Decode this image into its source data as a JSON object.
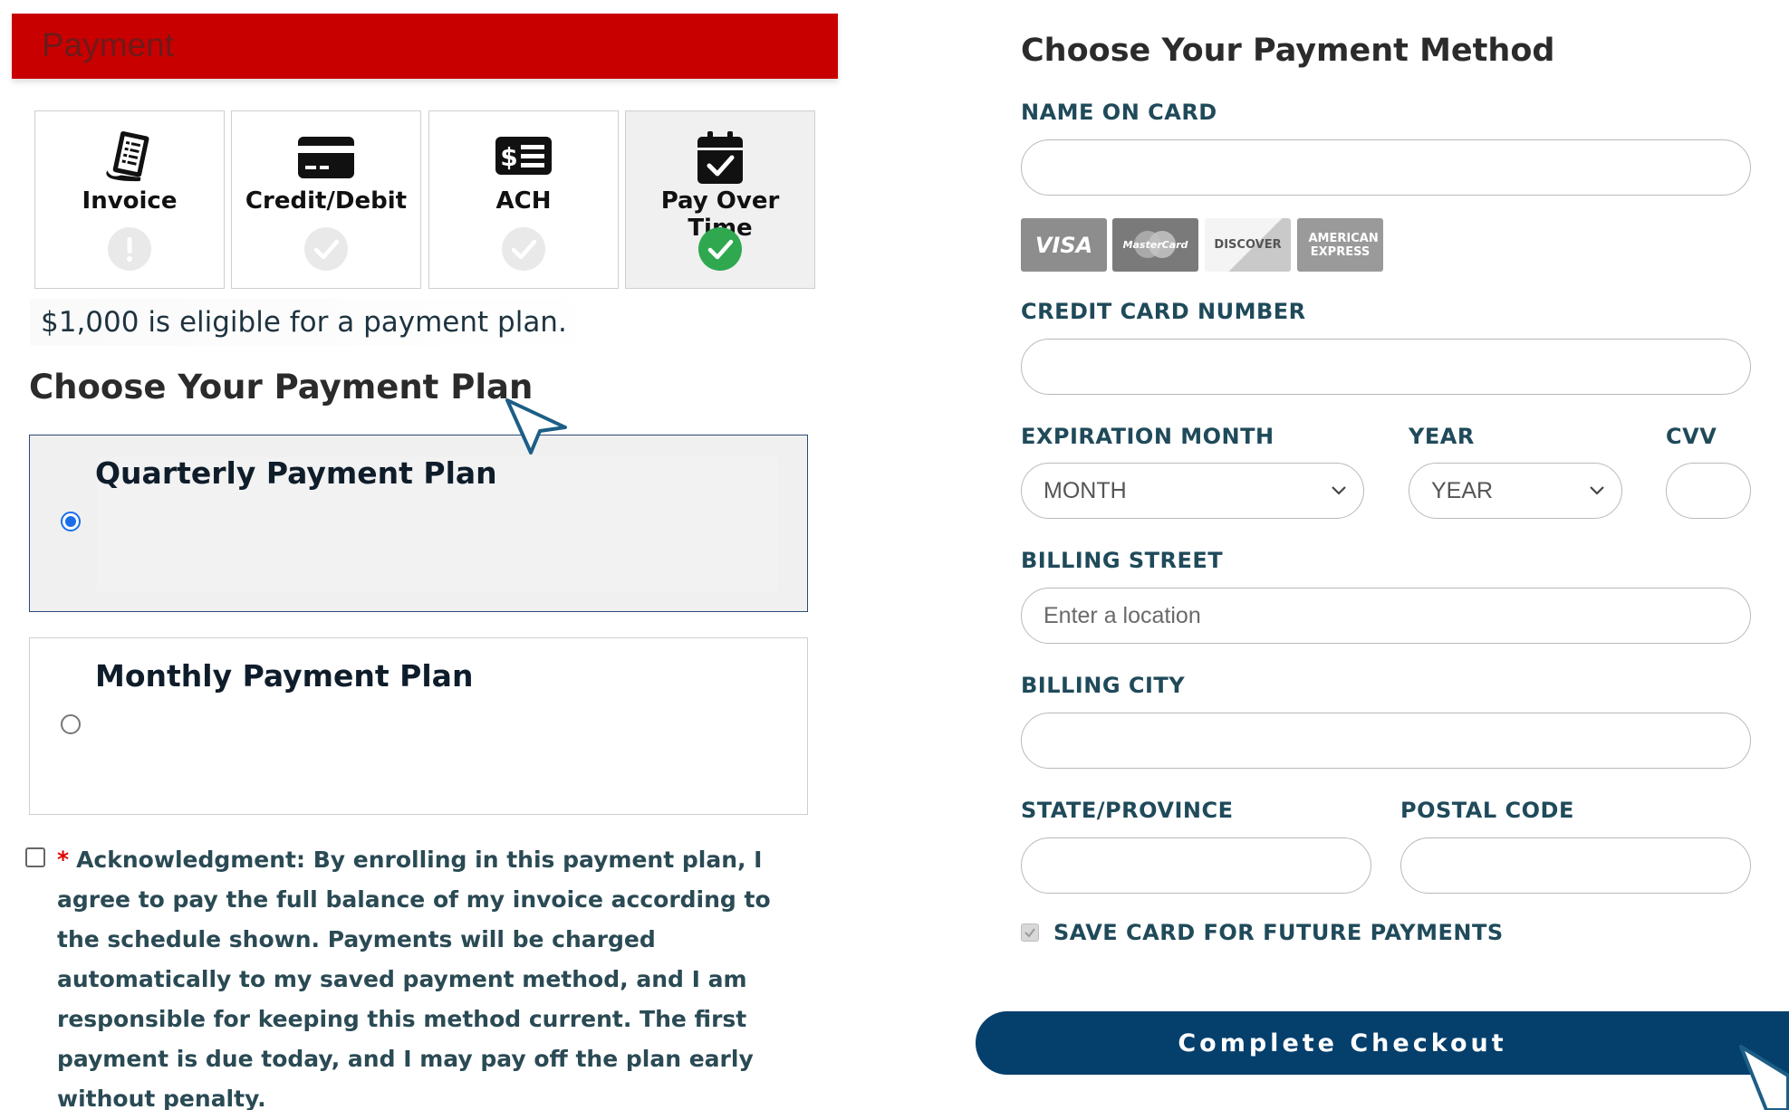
{
  "header": {
    "title": "Payment"
  },
  "tabs": [
    {
      "label": "Invoice",
      "icon": "invoice-icon",
      "status": "warning"
    },
    {
      "label": "Credit/Debit",
      "icon": "credit-card-icon",
      "status": "check"
    },
    {
      "label": "ACH",
      "icon": "ach-icon",
      "status": "check"
    },
    {
      "label": "Pay Over Time",
      "icon": "calendar-check-icon",
      "status": "selected"
    }
  ],
  "eligibility_text": "$1,000 is eligible for a payment plan.",
  "plan_section": {
    "heading": "Choose Your Payment Plan",
    "plans": [
      {
        "title": "Quarterly Payment Plan",
        "selected": true
      },
      {
        "title": "Monthly Payment Plan",
        "selected": false
      }
    ]
  },
  "acknowledgment": {
    "required_mark": "*",
    "text": "Acknowledgment: By enrolling in this payment plan, I agree to pay the full balance of my invoice according to the schedule shown. Payments will be charged automatically to my saved payment method, and I am responsible for keeping this method current. The first payment is due today, and I may pay off the plan early without penalty."
  },
  "payment_method": {
    "heading": "Choose Your Payment Method",
    "name_on_card_label": "NAME ON CARD",
    "card_brands": [
      "VISA",
      "MasterCard",
      "DISCOVER",
      "AMERICAN EXPRESS"
    ],
    "card_number_label": "CREDIT CARD NUMBER",
    "exp_month_label": "EXPIRATION MONTH",
    "exp_month_value": "MONTH",
    "year_label": "YEAR",
    "year_value": "YEAR",
    "cvv_label": "CVV",
    "billing_street_label": "BILLING STREET",
    "billing_street_placeholder": "Enter a location",
    "billing_city_label": "BILLING CITY",
    "state_label": "STATE/PROVINCE",
    "postal_label": "POSTAL CODE",
    "save_card_label": "SAVE CARD FOR FUTURE PAYMENTS",
    "checkout_label": "Complete Checkout"
  },
  "colors": {
    "header_red": "#c80000",
    "navy": "#053f6c",
    "success_green": "#2fa84f",
    "label_teal": "#1f4a5a"
  }
}
